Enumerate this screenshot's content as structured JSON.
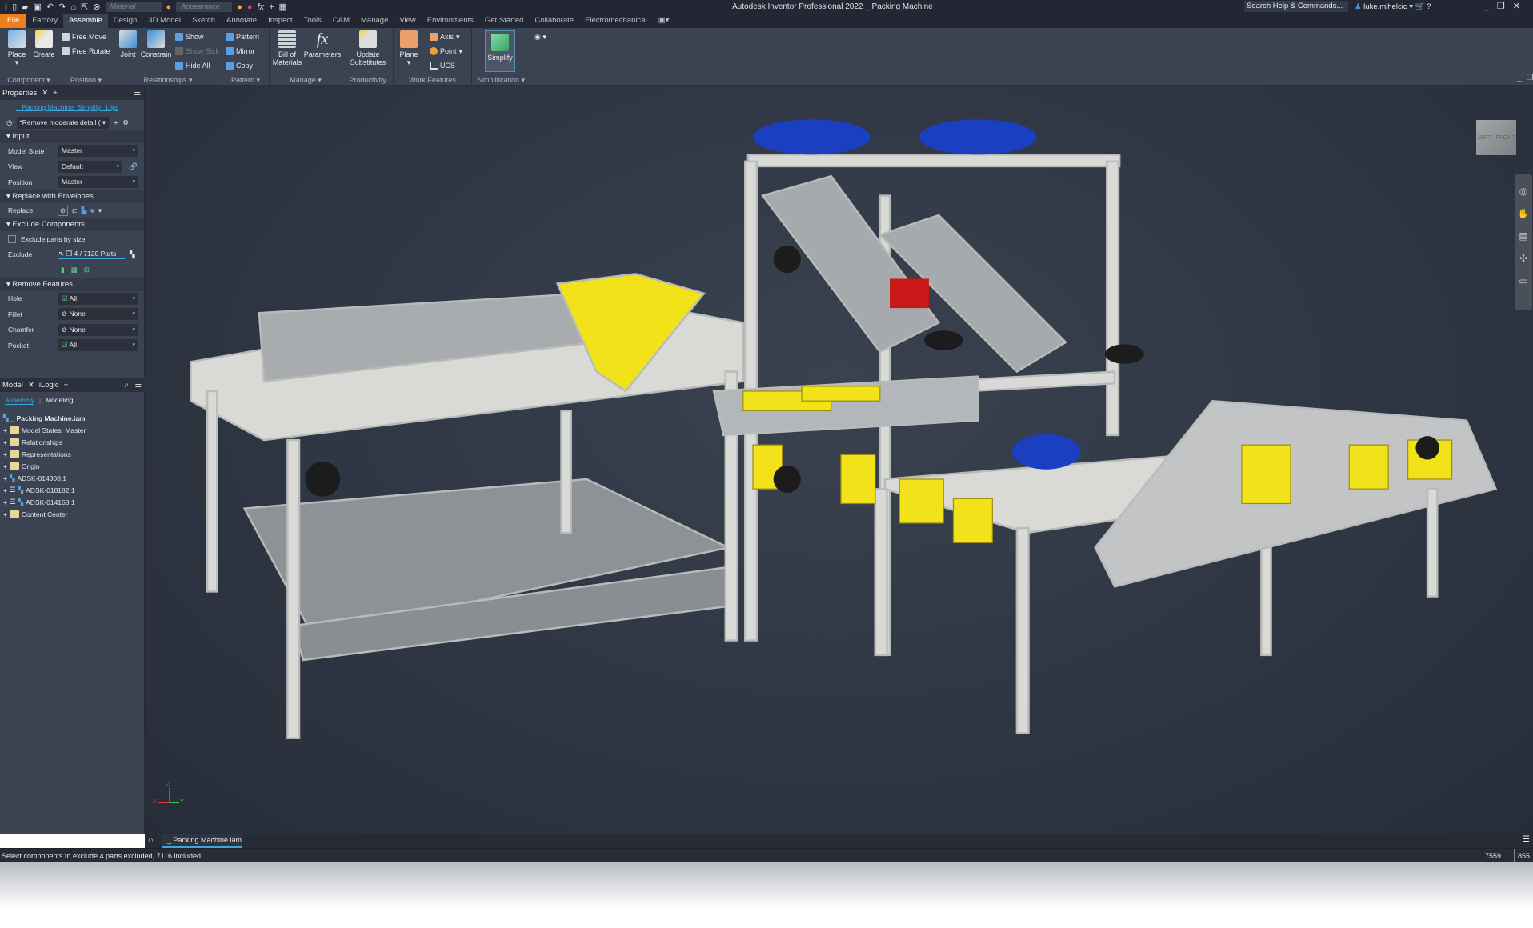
{
  "titlebar": {
    "app_title": "Autodesk Inventor Professional 2022  _ Packing Machine",
    "material_placeholder": "Material",
    "appearance_placeholder": "Appearance",
    "search": "Search Help & Commands...",
    "user": "luke.mihelcic"
  },
  "menu_tabs": [
    "File",
    "Factory",
    "Assemble",
    "Design",
    "3D Model",
    "Sketch",
    "Annotate",
    "Inspect",
    "Tools",
    "CAM",
    "Manage",
    "View",
    "Environments",
    "Get Started",
    "Collaborate",
    "Electromechanical"
  ],
  "active_tab": "Assemble",
  "ribbon": {
    "component": {
      "label": "Component",
      "place": "Place",
      "create": "Create"
    },
    "position": {
      "label": "Position",
      "free_move": "Free Move",
      "free_rotate": "Free Rotate"
    },
    "relationships": {
      "label": "Relationships",
      "joint": "Joint",
      "constrain": "Constrain",
      "show": "Show",
      "show_sick": "Show Sick",
      "hide_all": "Hide All"
    },
    "pattern": {
      "label": "Pattern",
      "pattern": "Pattern",
      "mirror": "Mirror",
      "copy": "Copy"
    },
    "manage": {
      "label": "Manage",
      "bom_1": "Bill of",
      "bom_2": "Materials",
      "parameters": "Parameters"
    },
    "productivity": {
      "label": "Productivity",
      "update_1": "Update",
      "update_2": "Substitutes"
    },
    "work_features": {
      "label": "Work Features",
      "plane": "Plane",
      "axis": "Axis",
      "point": "Point",
      "ucs": "UCS"
    },
    "simplification": {
      "label": "Simplification",
      "simplify": "Simplify"
    }
  },
  "properties": {
    "tab": "Properties",
    "file_link": "_ Packing Machine_Simplify_1.ipt",
    "preset": "*Remove moderate detail (",
    "input": {
      "title": "Input",
      "model_state_label": "Model State",
      "model_state": "Master",
      "view_label": "View",
      "view": "Default",
      "position_label": "Position",
      "position": "Master"
    },
    "envelopes": {
      "title": "Replace with Envelopes",
      "replace_label": "Replace"
    },
    "exclude": {
      "title": "Exclude Components",
      "by_size": "Exclude parts by size",
      "exclude_label": "Exclude",
      "count": "4 / 7120 Parts"
    },
    "remove": {
      "title": "Remove Features",
      "hole_label": "Hole",
      "hole": "All",
      "fillet_label": "Fillet",
      "fillet": "None",
      "chamfer_label": "Chamfer",
      "chamfer": "None",
      "pocket_label": "Pocket",
      "pocket": "All"
    }
  },
  "browser": {
    "tab_model": "Model",
    "tab_logic": "iLogic",
    "sub_assembly": "Assembly",
    "sub_modeling": "Modeling",
    "root": "_ Packing Machine.iam",
    "items": [
      "Model States: Master",
      "Relationships",
      "Representations",
      "Origin",
      "ADSK-014308:1",
      "ADSK-018182:1",
      "ADSK-014168:1",
      "Content Center"
    ]
  },
  "viewcube": {
    "left": "LEFT",
    "front": "FRONT"
  },
  "triad": {
    "x": "X",
    "y": "Y",
    "z": "Z"
  },
  "document_tab": "_ Packing Machine.iam",
  "status": {
    "message": "Select components to exclude.4 parts excluded, 7116 included.",
    "count_a": "7559",
    "count_b": "855"
  },
  "colors": {
    "accent_file": "#f07d1b",
    "link": "#3aa8e0",
    "frame": "#d9d9d6",
    "yellow": "#f2e21a",
    "motor_blue": "#1a3fc0",
    "background": "#2e3542"
  }
}
